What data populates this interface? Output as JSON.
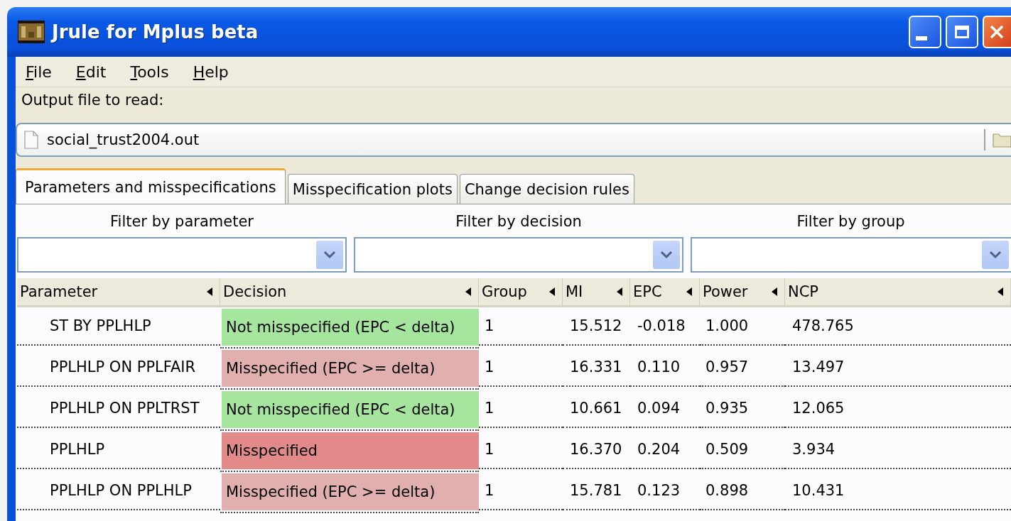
{
  "window": {
    "title": "Jrule for Mplus beta"
  },
  "menu": [
    {
      "label": "File"
    },
    {
      "label": "Edit"
    },
    {
      "label": "Tools"
    },
    {
      "label": "Help"
    }
  ],
  "file_picker": {
    "label": "Output file to read:",
    "value": "social_trust2004.out"
  },
  "tabs": [
    {
      "label": "Parameters and misspecifications",
      "selected": true
    },
    {
      "label": "Misspecification plots",
      "selected": false
    },
    {
      "label": "Change decision rules",
      "selected": false
    }
  ],
  "filters": [
    {
      "label": "Filter by parameter"
    },
    {
      "label": "Filter by decision"
    },
    {
      "label": "Filter by group"
    }
  ],
  "table": {
    "columns": [
      "Parameter",
      "Decision",
      "Group",
      "MI",
      "EPC",
      "Power",
      "NCP"
    ],
    "rows": [
      {
        "parameter": "ST BY PPLHLP",
        "decision": "Not misspecified (EPC < delta)",
        "color": "#a6e59e",
        "group": "1",
        "mi": "15.512",
        "epc": "-0.018",
        "power": "1.000",
        "ncp": "478.765"
      },
      {
        "parameter": "PPLHLP ON PPLFAIR",
        "decision": "Misspecified (EPC >= delta)",
        "color": "#e2afaf",
        "group": "1",
        "mi": "16.331",
        "epc": "0.110",
        "power": "0.957",
        "ncp": "13.497"
      },
      {
        "parameter": "PPLHLP ON PPLTRST",
        "decision": "Not misspecified (EPC < delta)",
        "color": "#a6e59e",
        "group": "1",
        "mi": "10.661",
        "epc": "0.094",
        "power": "0.935",
        "ncp": "12.065"
      },
      {
        "parameter": "PPLHLP",
        "decision": "Misspecified",
        "color": "#e28a8a",
        "group": "1",
        "mi": "16.370",
        "epc": "0.204",
        "power": "0.509",
        "ncp": "3.934"
      },
      {
        "parameter": "PPLHLP ON PPLHLP",
        "decision": "Misspecified (EPC >= delta)",
        "color": "#e2afaf",
        "group": "1",
        "mi": "15.781",
        "epc": "0.123",
        "power": "0.898",
        "ncp": "10.431"
      }
    ]
  }
}
